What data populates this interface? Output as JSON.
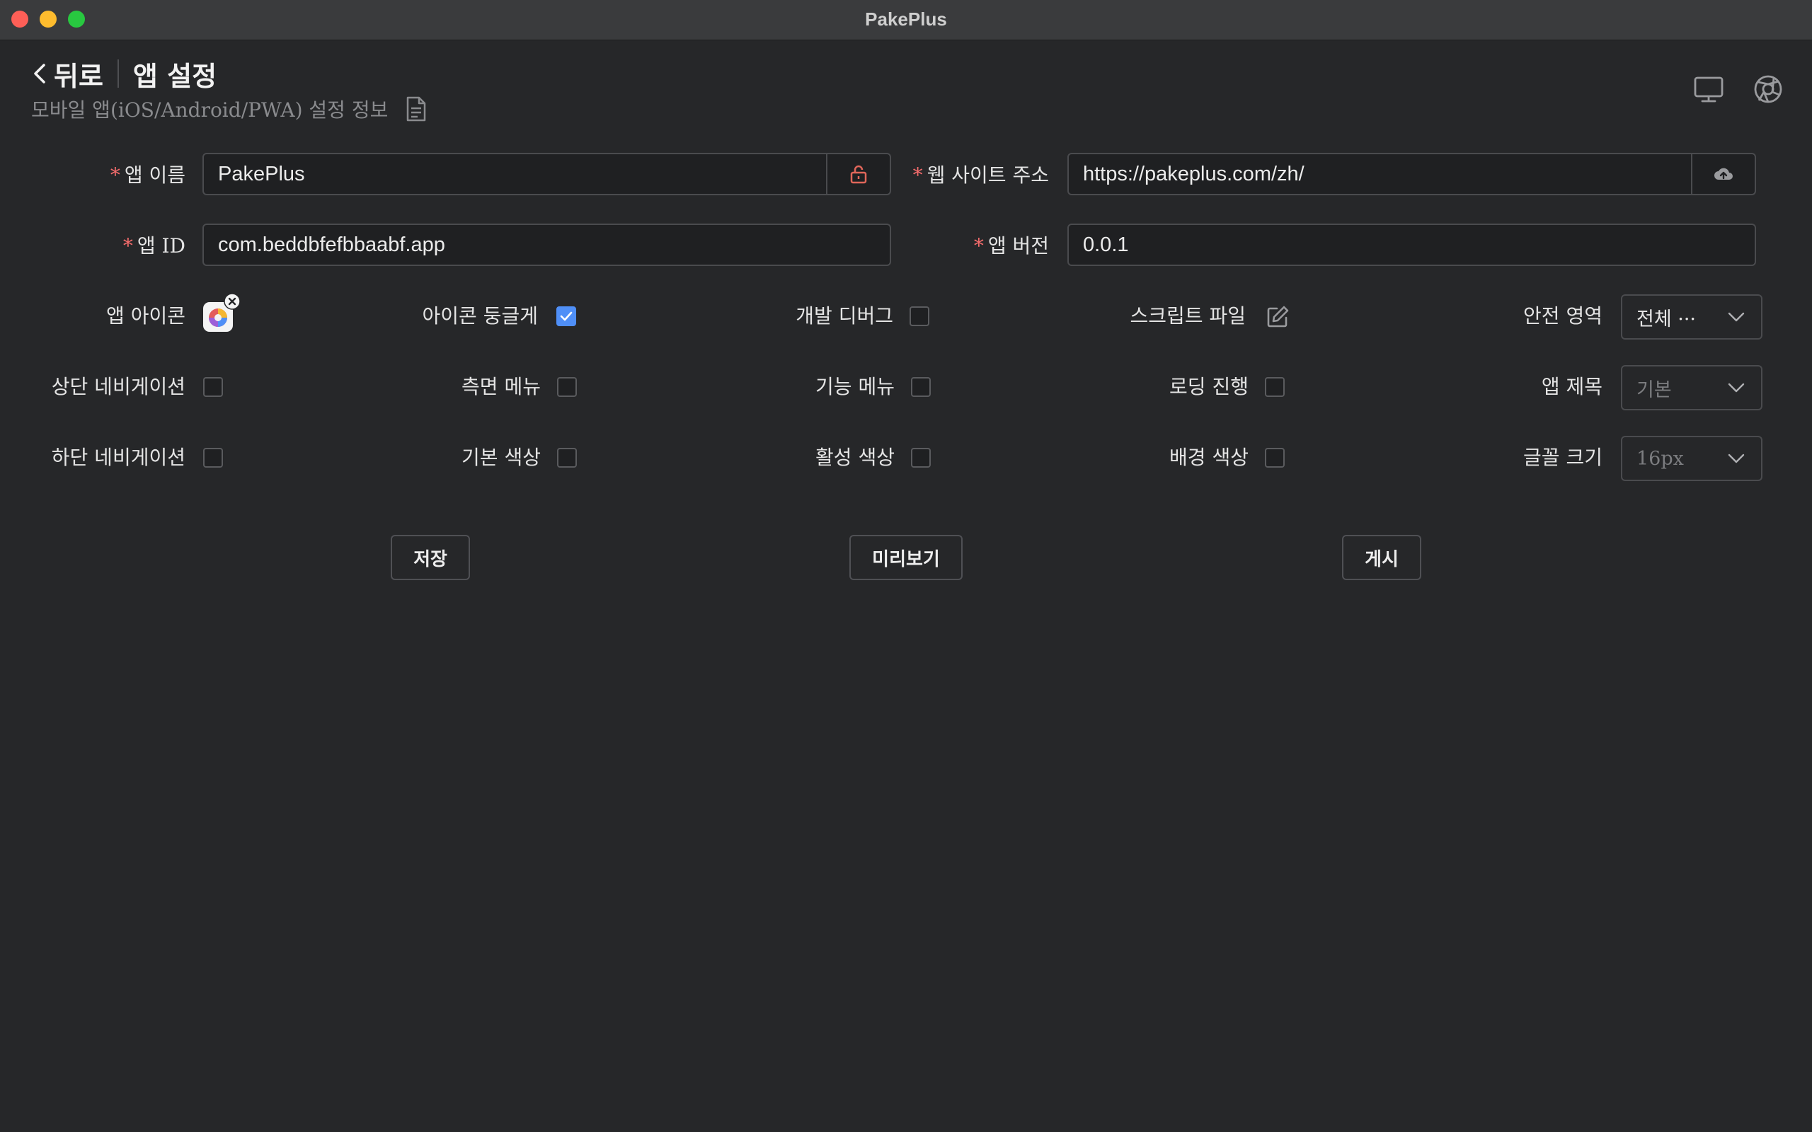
{
  "window": {
    "title": "PakePlus"
  },
  "header": {
    "back_label": "뒤로",
    "title": "앱 설정",
    "subtitle": "모바일 앱(iOS/Android/PWA) 설정 정보"
  },
  "form": {
    "app_name": {
      "label": "앱 이름",
      "value": "PakePlus"
    },
    "website": {
      "label": "웹 사이트 주소",
      "value": "https://pakeplus.com/zh/"
    },
    "app_id": {
      "label": "앱 ID",
      "value": "com.beddbfefbbaabf.app"
    },
    "app_version": {
      "label": "앱 버전",
      "value": "0.0.1"
    }
  },
  "options": {
    "app_icon": {
      "label": "앱 아이콘"
    },
    "round_icon": {
      "label": "아이콘 둥글게",
      "checked": true
    },
    "dev_debug": {
      "label": "개발 디버그",
      "checked": false
    },
    "script_file": {
      "label": "스크립트 파일"
    },
    "safe_area": {
      "label": "안전 영역",
      "value": "전체 ···"
    },
    "top_nav": {
      "label": "상단 네비게이션",
      "checked": false
    },
    "side_menu": {
      "label": "측면 메뉴",
      "checked": false
    },
    "func_menu": {
      "label": "기능 메뉴",
      "checked": false
    },
    "loading": {
      "label": "로딩 진행",
      "checked": false
    },
    "app_title": {
      "label": "앱 제목",
      "placeholder": "기본"
    },
    "bottom_nav": {
      "label": "하단 네비게이션",
      "checked": false
    },
    "base_color": {
      "label": "기본 색상",
      "checked": false
    },
    "active_color": {
      "label": "활성 색상",
      "checked": false
    },
    "bg_color": {
      "label": "배경 색상",
      "checked": false
    },
    "font_size": {
      "label": "글꼴 크기",
      "placeholder": "16px"
    }
  },
  "buttons": {
    "save": "저장",
    "preview": "미리보기",
    "publish": "게시"
  },
  "colors": {
    "accent": "#4f8ff7",
    "required": "#f56c6c",
    "lock": "#e0665a"
  }
}
